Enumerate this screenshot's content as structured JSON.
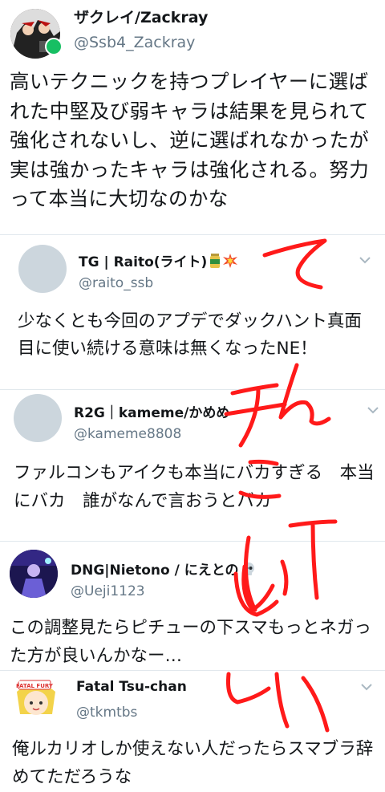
{
  "main_tweet": {
    "display_name": "ザクレイ/Zackray",
    "handle": "@Ssb4_Zackray",
    "text": "高いテクニックを持つプレイヤーに選ばれた中堅及び弱キャラは結果を見られて強化されないし、逆に選ばれなかったが実は強かったキャラは強化される。努力って本当に大切なのかな"
  },
  "replies": [
    {
      "display_name": "TG | Raito(ライト)",
      "handle": "@raito_ssb",
      "text": "少なくとも今回のアプデでダックハント真面目に使い続ける意味は無くなったNE！",
      "badges": [
        "jar-emoji",
        "collision-emoji"
      ]
    },
    {
      "display_name": "R2G｜kameme/かめめ",
      "handle": "@kameme8808",
      "text": "ファルコンもアイクも本当にバカすぎる　本当にバカ　誰がなんで言おうとバカ"
    },
    {
      "display_name": "DNG|Nietono / にえとの",
      "handle": "@Ueji1123",
      "text": "この調整見たらピチューの下スマもっとネガった方が良いんかなー…",
      "badges": [
        "skull-emoji"
      ]
    },
    {
      "display_name": "Fatal Tsu-chan",
      "handle": "@tkmtbs",
      "text": "俺ルカリオしか使えない人だったらスマブラ辞めてただろうな",
      "avatar_text": "FATAL FURY"
    }
  ],
  "colors": {
    "handle_gray": "#657786",
    "divider": "#e1e8ed",
    "scribble_red": "#ff1a1a",
    "chevron": "#aab8c2"
  }
}
